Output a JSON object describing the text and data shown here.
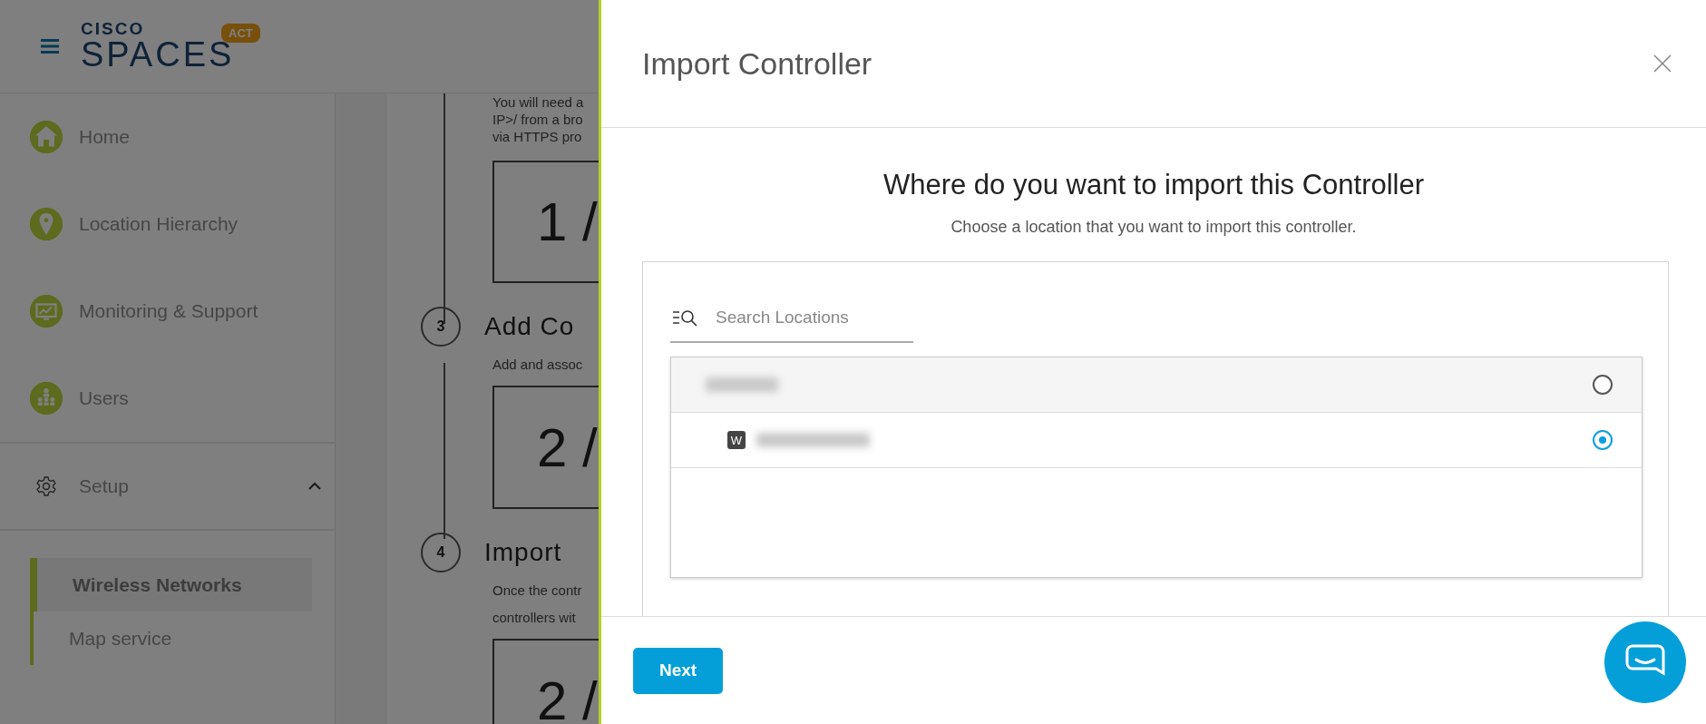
{
  "app": {
    "logo_top": "CISCO",
    "logo_bottom": "SPACES",
    "badge": "ACT"
  },
  "sidebar": {
    "items": [
      {
        "label": "Home",
        "kind": "home"
      },
      {
        "label": "Location Hierarchy",
        "kind": "pin"
      },
      {
        "label": "Monitoring & Support",
        "kind": "monitor"
      },
      {
        "label": "Users",
        "kind": "users"
      }
    ],
    "section": {
      "label": "Setup",
      "expanded": true,
      "children": [
        {
          "label": "Wireless Networks",
          "selected": true
        },
        {
          "label": "Map service",
          "selected": false
        }
      ]
    }
  },
  "steps_panel": {
    "intro_lines": [
      "You will need a",
      "IP>/ from a bro",
      "via HTTPS pro"
    ],
    "intro_box": "1 /",
    "steps": [
      {
        "number": "3",
        "title": "Add Co",
        "description_lines": [
          "Add and assoc"
        ],
        "box": "2 /"
      },
      {
        "number": "4",
        "title": "Import",
        "description_lines": [
          "Once the contr",
          "controllers wit"
        ],
        "box": "2 /"
      }
    ]
  },
  "dialog": {
    "title": "Import Controller",
    "heading": "Where do you want to import this Controller",
    "subtitle": "Choose a location that you want to import this controller.",
    "search": {
      "placeholder": "Search Locations"
    },
    "locations": [
      {
        "kind": "group",
        "selected": false
      },
      {
        "kind": "controller",
        "badge": "W",
        "selected": true
      }
    ],
    "next_button": "Next"
  }
}
